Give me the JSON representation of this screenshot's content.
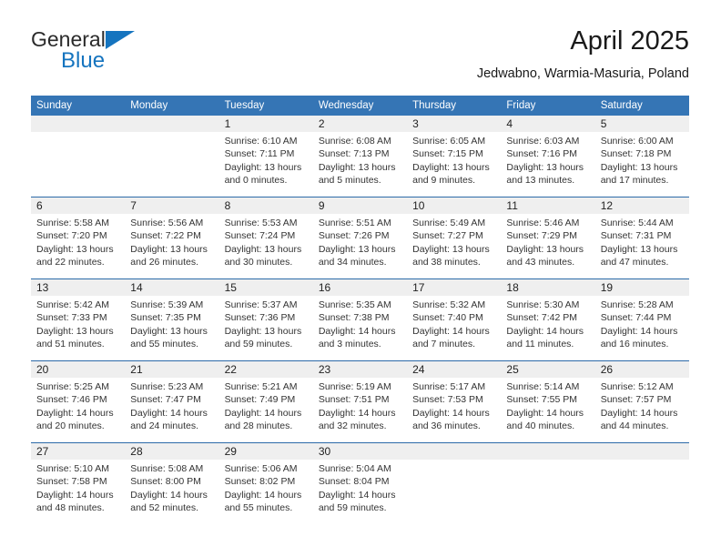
{
  "brand": {
    "name_part1": "General",
    "name_part2": "Blue",
    "accent_color": "#1574bf",
    "triangle_icon": "triangle-right-icon"
  },
  "header": {
    "title": "April 2025",
    "subtitle": "Jedwabno, Warmia-Masuria, Poland"
  },
  "calendar": {
    "header_bg": "#3575b5",
    "daynum_band_bg": "#efefef",
    "weekday_headers": [
      "Sunday",
      "Monday",
      "Tuesday",
      "Wednesday",
      "Thursday",
      "Friday",
      "Saturday"
    ],
    "weeks": [
      [
        {
          "day": "",
          "blank": true,
          "sunrise": "",
          "sunset": "",
          "daylight_l1": "",
          "daylight_l2": ""
        },
        {
          "day": "",
          "blank": true,
          "sunrise": "",
          "sunset": "",
          "daylight_l1": "",
          "daylight_l2": ""
        },
        {
          "day": "1",
          "sunrise": "Sunrise: 6:10 AM",
          "sunset": "Sunset: 7:11 PM",
          "daylight_l1": "Daylight: 13 hours",
          "daylight_l2": "and 0 minutes."
        },
        {
          "day": "2",
          "sunrise": "Sunrise: 6:08 AM",
          "sunset": "Sunset: 7:13 PM",
          "daylight_l1": "Daylight: 13 hours",
          "daylight_l2": "and 5 minutes."
        },
        {
          "day": "3",
          "sunrise": "Sunrise: 6:05 AM",
          "sunset": "Sunset: 7:15 PM",
          "daylight_l1": "Daylight: 13 hours",
          "daylight_l2": "and 9 minutes."
        },
        {
          "day": "4",
          "sunrise": "Sunrise: 6:03 AM",
          "sunset": "Sunset: 7:16 PM",
          "daylight_l1": "Daylight: 13 hours",
          "daylight_l2": "and 13 minutes."
        },
        {
          "day": "5",
          "sunrise": "Sunrise: 6:00 AM",
          "sunset": "Sunset: 7:18 PM",
          "daylight_l1": "Daylight: 13 hours",
          "daylight_l2": "and 17 minutes."
        }
      ],
      [
        {
          "day": "6",
          "sunrise": "Sunrise: 5:58 AM",
          "sunset": "Sunset: 7:20 PM",
          "daylight_l1": "Daylight: 13 hours",
          "daylight_l2": "and 22 minutes."
        },
        {
          "day": "7",
          "sunrise": "Sunrise: 5:56 AM",
          "sunset": "Sunset: 7:22 PM",
          "daylight_l1": "Daylight: 13 hours",
          "daylight_l2": "and 26 minutes."
        },
        {
          "day": "8",
          "sunrise": "Sunrise: 5:53 AM",
          "sunset": "Sunset: 7:24 PM",
          "daylight_l1": "Daylight: 13 hours",
          "daylight_l2": "and 30 minutes."
        },
        {
          "day": "9",
          "sunrise": "Sunrise: 5:51 AM",
          "sunset": "Sunset: 7:26 PM",
          "daylight_l1": "Daylight: 13 hours",
          "daylight_l2": "and 34 minutes."
        },
        {
          "day": "10",
          "sunrise": "Sunrise: 5:49 AM",
          "sunset": "Sunset: 7:27 PM",
          "daylight_l1": "Daylight: 13 hours",
          "daylight_l2": "and 38 minutes."
        },
        {
          "day": "11",
          "sunrise": "Sunrise: 5:46 AM",
          "sunset": "Sunset: 7:29 PM",
          "daylight_l1": "Daylight: 13 hours",
          "daylight_l2": "and 43 minutes."
        },
        {
          "day": "12",
          "sunrise": "Sunrise: 5:44 AM",
          "sunset": "Sunset: 7:31 PM",
          "daylight_l1": "Daylight: 13 hours",
          "daylight_l2": "and 47 minutes."
        }
      ],
      [
        {
          "day": "13",
          "sunrise": "Sunrise: 5:42 AM",
          "sunset": "Sunset: 7:33 PM",
          "daylight_l1": "Daylight: 13 hours",
          "daylight_l2": "and 51 minutes."
        },
        {
          "day": "14",
          "sunrise": "Sunrise: 5:39 AM",
          "sunset": "Sunset: 7:35 PM",
          "daylight_l1": "Daylight: 13 hours",
          "daylight_l2": "and 55 minutes."
        },
        {
          "day": "15",
          "sunrise": "Sunrise: 5:37 AM",
          "sunset": "Sunset: 7:36 PM",
          "daylight_l1": "Daylight: 13 hours",
          "daylight_l2": "and 59 minutes."
        },
        {
          "day": "16",
          "sunrise": "Sunrise: 5:35 AM",
          "sunset": "Sunset: 7:38 PM",
          "daylight_l1": "Daylight: 14 hours",
          "daylight_l2": "and 3 minutes."
        },
        {
          "day": "17",
          "sunrise": "Sunrise: 5:32 AM",
          "sunset": "Sunset: 7:40 PM",
          "daylight_l1": "Daylight: 14 hours",
          "daylight_l2": "and 7 minutes."
        },
        {
          "day": "18",
          "sunrise": "Sunrise: 5:30 AM",
          "sunset": "Sunset: 7:42 PM",
          "daylight_l1": "Daylight: 14 hours",
          "daylight_l2": "and 11 minutes."
        },
        {
          "day": "19",
          "sunrise": "Sunrise: 5:28 AM",
          "sunset": "Sunset: 7:44 PM",
          "daylight_l1": "Daylight: 14 hours",
          "daylight_l2": "and 16 minutes."
        }
      ],
      [
        {
          "day": "20",
          "sunrise": "Sunrise: 5:25 AM",
          "sunset": "Sunset: 7:46 PM",
          "daylight_l1": "Daylight: 14 hours",
          "daylight_l2": "and 20 minutes."
        },
        {
          "day": "21",
          "sunrise": "Sunrise: 5:23 AM",
          "sunset": "Sunset: 7:47 PM",
          "daylight_l1": "Daylight: 14 hours",
          "daylight_l2": "and 24 minutes."
        },
        {
          "day": "22",
          "sunrise": "Sunrise: 5:21 AM",
          "sunset": "Sunset: 7:49 PM",
          "daylight_l1": "Daylight: 14 hours",
          "daylight_l2": "and 28 minutes."
        },
        {
          "day": "23",
          "sunrise": "Sunrise: 5:19 AM",
          "sunset": "Sunset: 7:51 PM",
          "daylight_l1": "Daylight: 14 hours",
          "daylight_l2": "and 32 minutes."
        },
        {
          "day": "24",
          "sunrise": "Sunrise: 5:17 AM",
          "sunset": "Sunset: 7:53 PM",
          "daylight_l1": "Daylight: 14 hours",
          "daylight_l2": "and 36 minutes."
        },
        {
          "day": "25",
          "sunrise": "Sunrise: 5:14 AM",
          "sunset": "Sunset: 7:55 PM",
          "daylight_l1": "Daylight: 14 hours",
          "daylight_l2": "and 40 minutes."
        },
        {
          "day": "26",
          "sunrise": "Sunrise: 5:12 AM",
          "sunset": "Sunset: 7:57 PM",
          "daylight_l1": "Daylight: 14 hours",
          "daylight_l2": "and 44 minutes."
        }
      ],
      [
        {
          "day": "27",
          "sunrise": "Sunrise: 5:10 AM",
          "sunset": "Sunset: 7:58 PM",
          "daylight_l1": "Daylight: 14 hours",
          "daylight_l2": "and 48 minutes."
        },
        {
          "day": "28",
          "sunrise": "Sunrise: 5:08 AM",
          "sunset": "Sunset: 8:00 PM",
          "daylight_l1": "Daylight: 14 hours",
          "daylight_l2": "and 52 minutes."
        },
        {
          "day": "29",
          "sunrise": "Sunrise: 5:06 AM",
          "sunset": "Sunset: 8:02 PM",
          "daylight_l1": "Daylight: 14 hours",
          "daylight_l2": "and 55 minutes."
        },
        {
          "day": "30",
          "sunrise": "Sunrise: 5:04 AM",
          "sunset": "Sunset: 8:04 PM",
          "daylight_l1": "Daylight: 14 hours",
          "daylight_l2": "and 59 minutes."
        },
        {
          "day": "",
          "blank": true,
          "sunrise": "",
          "sunset": "",
          "daylight_l1": "",
          "daylight_l2": ""
        },
        {
          "day": "",
          "blank": true,
          "sunrise": "",
          "sunset": "",
          "daylight_l1": "",
          "daylight_l2": ""
        },
        {
          "day": "",
          "blank": true,
          "sunrise": "",
          "sunset": "",
          "daylight_l1": "",
          "daylight_l2": ""
        }
      ]
    ]
  }
}
